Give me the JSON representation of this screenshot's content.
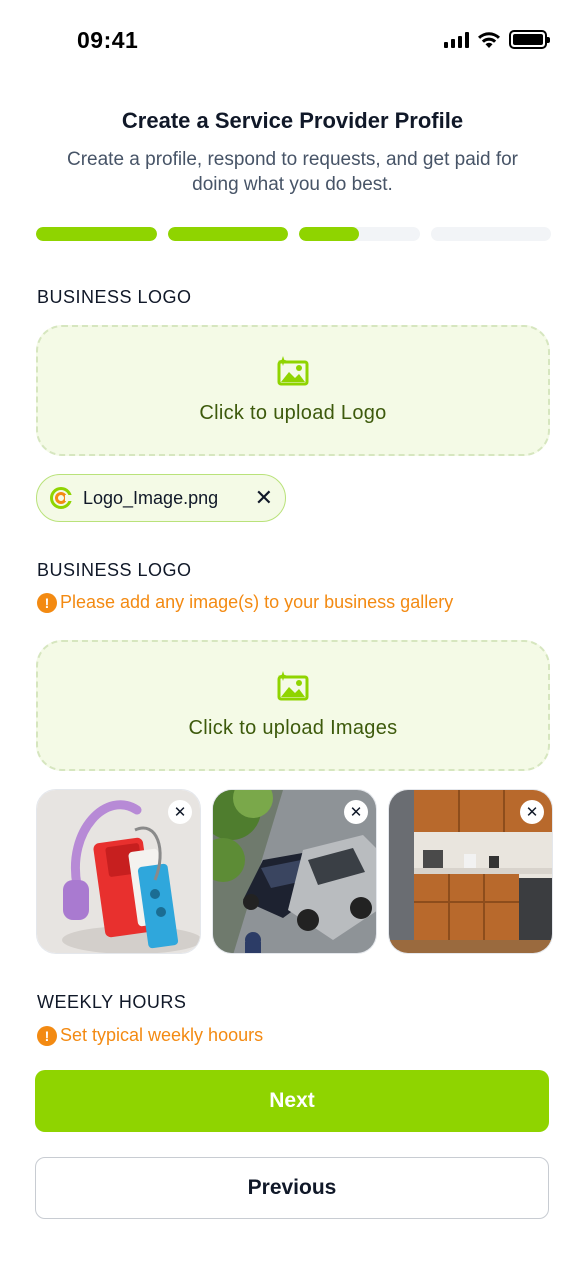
{
  "status_bar": {
    "time": "09:41"
  },
  "header": {
    "title": "Create a Service Provider Profile",
    "subtitle": "Create a profile, respond to requests, and get paid for doing what you do best."
  },
  "progress": {
    "steps": [
      1,
      1,
      0.5,
      0
    ]
  },
  "logo_section": {
    "label": "BUSINESS LOGO",
    "upload_text": "Click to upload Logo",
    "file_name": "Logo_Image.png"
  },
  "gallery_section": {
    "label": "BUSINESS LOGO",
    "hint": "Please add any image(s) to your business gallery",
    "upload_text": "Click to upload Images",
    "images": [
      "headphones-cassette-image",
      "car-collision-image",
      "wooden-kitchen-image"
    ]
  },
  "hours_section": {
    "label": "WEEKLY HOURS",
    "hint": "Set typical weekly hoours"
  },
  "buttons": {
    "next": "Next",
    "previous": "Previous"
  },
  "colors": {
    "accent": "#8fd400",
    "warning": "#f38a12",
    "upload_bg": "#f4fae6"
  }
}
